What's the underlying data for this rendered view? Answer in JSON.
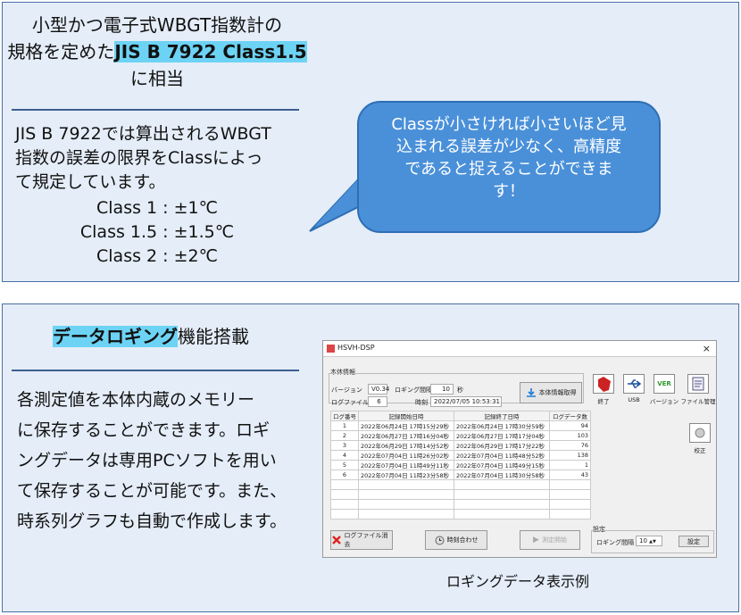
{
  "top": {
    "title_line1": "小型かつ電子式WBGT指数計の",
    "title_line2_prefix": "規格を定めた",
    "title_line2_highlight": "JIS B 7922 Class1.5",
    "title_line3": "に相当",
    "desc_line1": "JIS B 7922では算出されるWBGT",
    "desc_line2": "指数の誤差の限界をClassによっ",
    "desc_line3": "て規定しています。",
    "classes": [
      "Class 1 : ±1℃",
      "Class 1.5 : ±1.5℃",
      "Class 2 : ±2℃"
    ],
    "bubble_line1": "Classが小さければ小さいほど見",
    "bubble_line2": "込まれる誤差が少なく、高精度",
    "bubble_line3": "であると捉えることができま",
    "bubble_line4": "す！"
  },
  "bottom": {
    "heading_highlight": "データロギング",
    "heading_rest": "機能搭載",
    "desc_lines": [
      "各測定値を本体内蔵のメモリー",
      "に保存することができます。ロギ",
      "ングデータは専用PCソフトを用い",
      "て保存することが可能です。また、",
      "時系列グラフも自動で作成します。"
    ],
    "caption": "ロギングデータ表示例"
  },
  "app": {
    "window_title": "HSVH-DSP",
    "close_glyph": "×",
    "info_group": "本体情報",
    "version_label": "バージョン",
    "version_value": "V0.34",
    "interval_label": "ロギング間隔",
    "interval_value": "10",
    "interval_unit": "秒",
    "logcount_label": "ログファイル数",
    "logcount_value": "6",
    "time_label": "時刻",
    "time_value": "2022/07/05 10:53:31",
    "fetch_button": "本体情報取得",
    "table_headers": [
      "ログ番号",
      "記録開始日時",
      "記録終了日時",
      "ログデータ数"
    ],
    "rows": [
      [
        "1",
        "2022年06月24日 17時15分29秒",
        "2022年06月24日 17時30分59秒",
        "94"
      ],
      [
        "2",
        "2022年06月27日 17時16分04秒",
        "2022年06月27日 17時17分04秒",
        "103"
      ],
      [
        "3",
        "2022年06月29日 17時14分52秒",
        "2022年06月29日 17時17分22秒",
        "76"
      ],
      [
        "4",
        "2022年07月04日 11時26分02秒",
        "2022年07月04日 11時48分52秒",
        "138"
      ],
      [
        "5",
        "2022年07月04日 11時49分11秒",
        "2022年07月04日 11時49分15秒",
        "1"
      ],
      [
        "6",
        "2022年07月04日 11時23分58秒",
        "2022年07月04日 11時30分58秒",
        "43"
      ]
    ],
    "delete_button": "ログファイル消去",
    "timesync_button": "時刻合わせ",
    "stop_button": "測定開始",
    "exit_label": "終了",
    "usb_label": "USB",
    "version_btn_label": "バージョン",
    "filemgr_label": "ファイル管理",
    "calib_label": "校正",
    "settings_group": "設定",
    "settings_interval_label": "ロギング間隔",
    "settings_interval_value": "10",
    "settings_button": "設定",
    "ver_icon_text": "VER"
  },
  "colors": {
    "panel_bg": "#e4edf8",
    "highlight": "#6dd3f5",
    "bubble": "#4a90d9",
    "rule": "#3c5f8f"
  }
}
